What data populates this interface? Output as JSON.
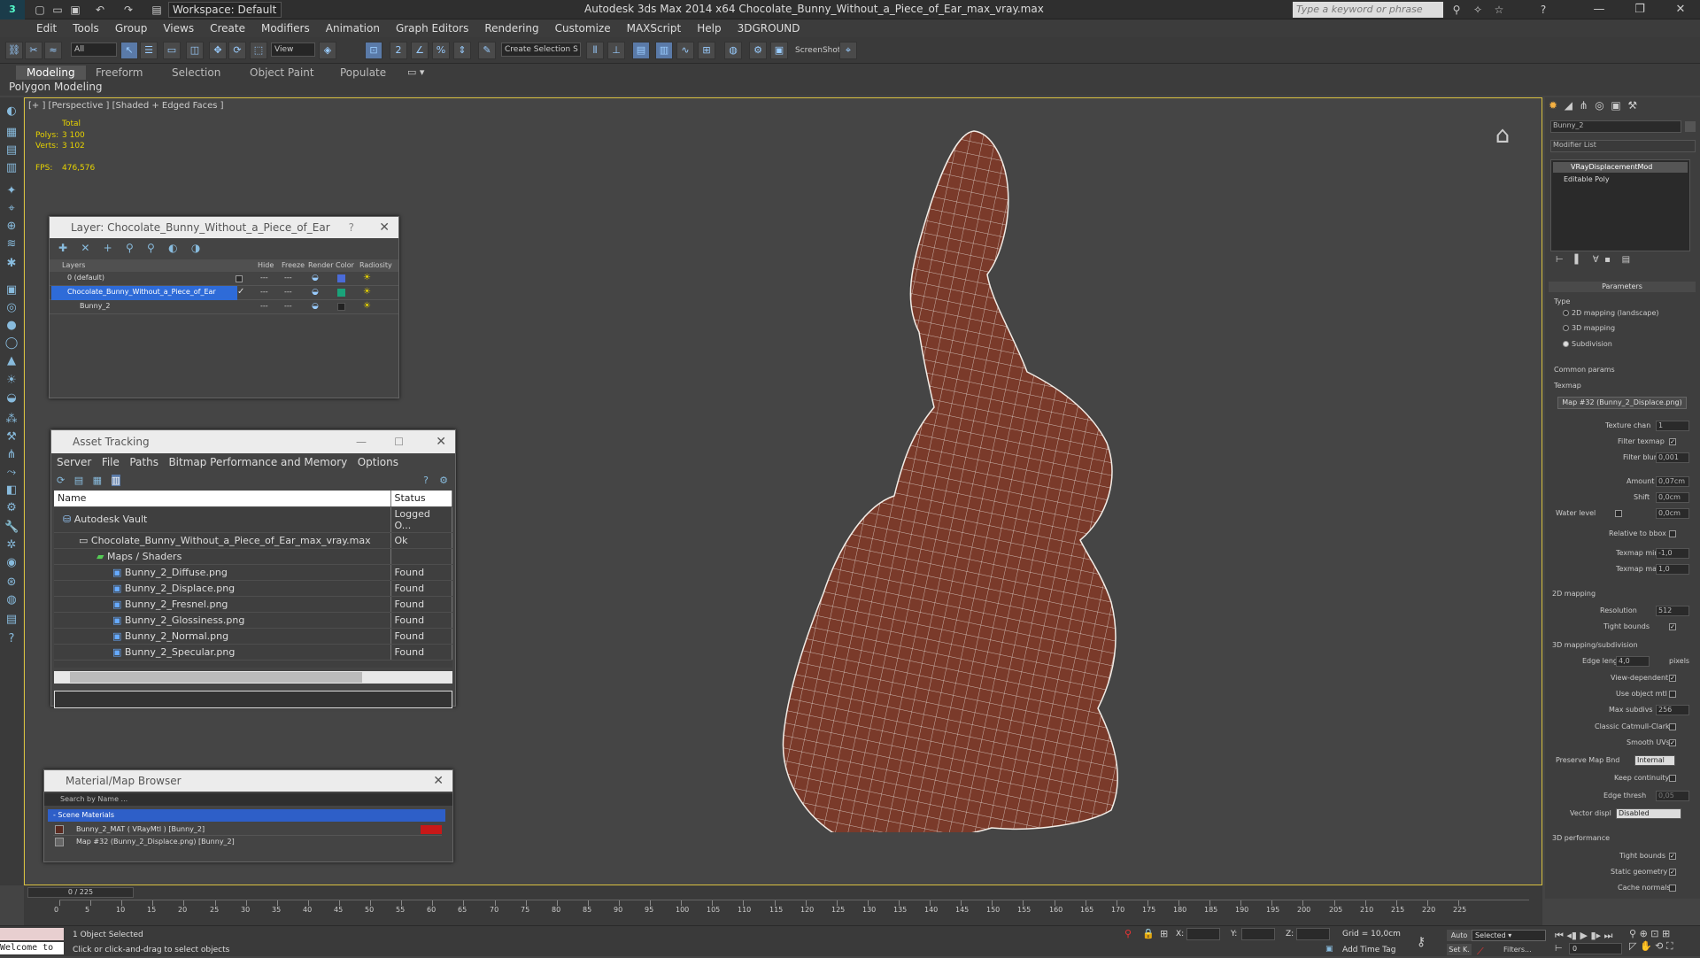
{
  "window": {
    "title": "Autodesk 3ds Max  2014 x64     Chocolate_Bunny_Without_a_Piece_of_Ear_max_vray.max",
    "workspace": "Workspace: Default",
    "search_placeholder": "Type a keyword or phrase",
    "controls": {
      "minimize": "—",
      "restore": "❐",
      "close": "✕"
    }
  },
  "menu": [
    "Edit",
    "Tools",
    "Group",
    "Views",
    "Create",
    "Modifiers",
    "Animation",
    "Graph Editors",
    "Rendering",
    "Customize",
    "MAXScript",
    "Help",
    "3DGROUND"
  ],
  "toolbar": {
    "selection_filter": "All",
    "ref_coord": "View",
    "named_selection": "Create Selection S",
    "screenshot_label": "ScreenShot"
  },
  "ribbon": {
    "tabs": [
      "Modeling",
      "Freeform",
      "Selection",
      "Object Paint",
      "Populate"
    ],
    "active_tab": "Modeling",
    "subtitle": "Polygon Modeling"
  },
  "viewport": {
    "label": "[+ ] [Perspective ] [Shaded + Edged Faces ]",
    "stats": {
      "total_label": "Total",
      "polys_label": "Polys:",
      "polys_value": "3 100",
      "verts_label": "Verts:",
      "verts_value": "3 102",
      "fps_label": "FPS:",
      "fps_value": "476,576"
    },
    "mesh_color": "#7a3a2a"
  },
  "layer_panel": {
    "title": "Layer: Chocolate_Bunny_Without_a_Piece_of_Ear",
    "help": "?",
    "columns": [
      "Layers",
      "Hide",
      "Freeze",
      "Render",
      "Color",
      "Radiosity"
    ],
    "rows": [
      {
        "name": "0 (default)",
        "color": "#4a6bd8"
      },
      {
        "name": "Chocolate_Bunny_Without_a_Piece_of_Ear",
        "color": "#1aa37a"
      },
      {
        "name": "Bunny_2",
        "color": "#222222"
      }
    ]
  },
  "asset_panel": {
    "title": "Asset Tracking",
    "menu": [
      "Server",
      "File",
      "Paths",
      "Bitmap Performance and Memory",
      "Options"
    ],
    "columns": [
      "Name",
      "Status"
    ],
    "rows": [
      {
        "name": "Autodesk Vault",
        "status": "Logged O..."
      },
      {
        "name": "Chocolate_Bunny_Without_a_Piece_of_Ear_max_vray.max",
        "status": "Ok"
      },
      {
        "name": "Maps / Shaders",
        "status": ""
      },
      {
        "name": "Bunny_2_Diffuse.png",
        "status": "Found"
      },
      {
        "name": "Bunny_2_Displace.png",
        "status": "Found"
      },
      {
        "name": "Bunny_2_Fresnel.png",
        "status": "Found"
      },
      {
        "name": "Bunny_2_Glossiness.png",
        "status": "Found"
      },
      {
        "name": "Bunny_2_Normal.png",
        "status": "Found"
      },
      {
        "name": "Bunny_2_Specular.png",
        "status": "Found"
      }
    ]
  },
  "material_panel": {
    "title": "Material/Map Browser",
    "search_placeholder": "Search by Name ...",
    "group": "- Scene Materials",
    "items": [
      "Bunny_2_MAT  ( VRayMtl )  [Bunny_2]",
      "Map #32 (Bunny_2_Displace.png)  [Bunny_2]"
    ]
  },
  "command_panel": {
    "object_name": "Bunny_2",
    "modifier_list": "Modifier List",
    "stack": [
      "VRayDisplacementMod",
      "Editable Poly"
    ],
    "rollout_title": "Parameters",
    "type_label": "Type",
    "type_options": [
      "2D mapping (landscape)",
      "3D mapping",
      "Subdivision"
    ],
    "type_selected": "Subdivision",
    "common_params": "Common params",
    "texmap_label": "Texmap",
    "texmap_value": "Map #32 (Bunny_2_Displace.png)",
    "texture_chan_label": "Texture chan",
    "texture_chan": "1",
    "filter_texmap": "Filter texmap",
    "filter_blur_label": "Filter blur",
    "filter_blur": "0,001",
    "amount_label": "Amount",
    "amount": "0,07cm",
    "shift_label": "Shift",
    "shift": "0,0cm",
    "water_level_label": "Water level",
    "water_level": "0,0cm",
    "relative_bbox": "Relative to bbox",
    "texmap_min_label": "Texmap min",
    "texmap_min": "-1,0",
    "texmap_max_label": "Texmap max",
    "texmap_max": "1,0",
    "mapping2d": "2D mapping",
    "resolution_label": "Resolution",
    "resolution": "512",
    "tight_bounds": "Tight bounds",
    "mapping3d": "3D mapping/subdivision",
    "edge_length_label": "Edge length",
    "edge_length": "4,0",
    "pixels": "pixels",
    "view_dependent": "View-dependent",
    "use_object_mtl": "Use object mtl",
    "max_subdivs_label": "Max subdivs",
    "max_subdivs": "256",
    "catmull": "Classic Catmull-Clark",
    "smooth_uvs": "Smooth UVs",
    "preserve_label": "Preserve Map Bnd",
    "preserve_value": "Internal",
    "keep_continuity": "Keep continuity",
    "edge_thresh_label": "Edge thresh",
    "edge_thresh": "0,05",
    "vector_displ_label": "Vector displ",
    "vector_displ": "Disabled",
    "perf_title": "3D performance",
    "tight_bounds2": "Tight bounds",
    "static_geometry": "Static geometry",
    "cache_normals": "Cache normals"
  },
  "timeline": {
    "frame": "0 / 225",
    "ticks": [
      "0",
      "5",
      "10",
      "15",
      "20",
      "25",
      "30",
      "35",
      "40",
      "45",
      "50",
      "55",
      "60",
      "65",
      "70",
      "75",
      "80",
      "85",
      "90",
      "95",
      "100",
      "105",
      "110",
      "115",
      "120",
      "125",
      "130",
      "135",
      "140",
      "145",
      "150",
      "155",
      "160",
      "165",
      "170",
      "175",
      "180",
      "185",
      "190",
      "195",
      "200",
      "205",
      "210",
      "215",
      "220",
      "225"
    ]
  },
  "status": {
    "listener": "Welcome to",
    "selected": "1 Object Selected",
    "prompt": "Click or click-and-drag to select objects",
    "x_label": "X:",
    "y_label": "Y:",
    "z_label": "Z:",
    "grid": "Grid = 10,0cm",
    "add_time_tag": "Add Time Tag",
    "auto": "Auto",
    "set_key": "Set K.",
    "key_mode": "Selected",
    "filters": "Filters...",
    "frame_field": "0"
  }
}
